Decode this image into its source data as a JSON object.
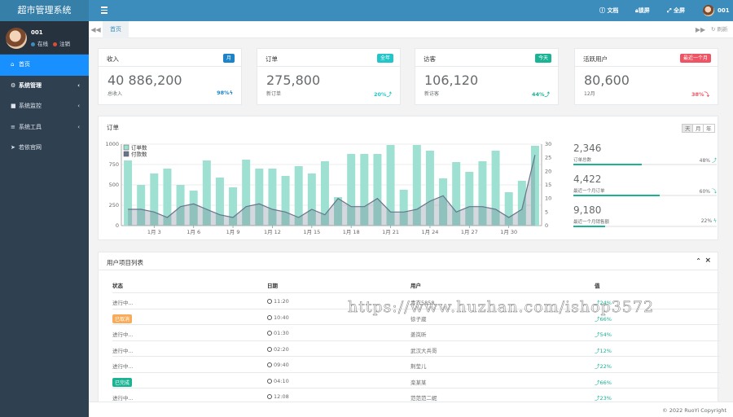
{
  "app": {
    "title": "超市管理系统"
  },
  "user": {
    "name": "001",
    "status": "在线",
    "logout": "注销"
  },
  "sidebar": {
    "items": [
      {
        "icon": "home-icon",
        "label": "首页",
        "arrow": ""
      },
      {
        "icon": "gear-icon",
        "label": "系统管理",
        "arrow": "‹"
      },
      {
        "icon": "video-icon",
        "label": "系统监控",
        "arrow": "‹"
      },
      {
        "icon": "bars-icon",
        "label": "系统工具",
        "arrow": "‹"
      },
      {
        "icon": "location-arrow-icon",
        "label": "若依官网",
        "arrow": ""
      }
    ]
  },
  "topbar": {
    "docs": "文档",
    "lock": "锁屏",
    "fullscreen": "全屏",
    "user": "001"
  },
  "tabs": {
    "home": "首页",
    "refresh": "刷新"
  },
  "stats": [
    {
      "title": "收入",
      "badge": "月",
      "badge_color": "#1c84c6",
      "value": "40 886,200",
      "sub": "总收入",
      "pct": "98%",
      "pct_color": "#1c84c6",
      "icon": "bolt-icon",
      "glyph": "ϟ"
    },
    {
      "title": "订单",
      "badge": "全年",
      "badge_color": "#23c6c8",
      "value": "275,800",
      "sub": "新订单",
      "pct": "20%",
      "pct_color": "#23c6c8",
      "icon": "level-up-icon",
      "glyph": "⤴"
    },
    {
      "title": "访客",
      "badge": "今天",
      "badge_color": "#1ab394",
      "value": "106,120",
      "sub": "新访客",
      "pct": "44%",
      "pct_color": "#1ab394",
      "icon": "level-up-icon",
      "glyph": "⤴"
    },
    {
      "title": "活跃用户",
      "badge": "最近一个月",
      "badge_color": "#ed5565",
      "value": "80,600",
      "sub": "12月",
      "pct": "38%",
      "pct_color": "#ed5565",
      "icon": "level-down-icon",
      "glyph": "⤵"
    }
  ],
  "orders_panel": {
    "title": "订单",
    "periods": [
      "天",
      "月",
      "年"
    ],
    "side_stats": [
      {
        "value": "2,346",
        "label": "订单总数",
        "pct": "48%",
        "icon": "bolt-icon",
        "glyph": "⤴",
        "fill": 0.48
      },
      {
        "value": "4,422",
        "label": "最近一个月订单",
        "pct": "60%",
        "icon": "level-down-icon",
        "glyph": "⤵",
        "fill": 0.6
      },
      {
        "value": "9,180",
        "label": "最近一个月销售额",
        "pct": "22%",
        "icon": "bolt-icon",
        "glyph": "ϟ",
        "fill": 0.22
      }
    ]
  },
  "chart_data": {
    "type": "bar",
    "legend_position": "top-left",
    "series": [
      {
        "name": "订单数",
        "type": "bar",
        "axis": "left",
        "color": "#9ee0d2",
        "values": [
          800,
          500,
          640,
          700,
          500,
          430,
          800,
          590,
          470,
          810,
          700,
          700,
          610,
          730,
          640,
          790,
          350,
          880,
          880,
          880,
          990,
          440,
          990,
          920,
          580,
          780,
          660,
          790,
          920,
          410,
          550,
          980
        ]
      },
      {
        "name": "付款数",
        "type": "line",
        "axis": "right",
        "color": "#67748a",
        "values": [
          6,
          6,
          5,
          3,
          7,
          8,
          6,
          4,
          3,
          7,
          8,
          6,
          5,
          3,
          6,
          4,
          10,
          7,
          7,
          10,
          5,
          5,
          6,
          9,
          11,
          5,
          7,
          7,
          6,
          3,
          6,
          26
        ]
      }
    ],
    "x_ticks": [
      "1月 3",
      "1月 6",
      "1月 9",
      "1月 12",
      "1月 15",
      "1月 18",
      "1月 21",
      "1月 24",
      "1月 27",
      "1月 30"
    ],
    "x_tick_index": [
      2,
      5,
      8,
      11,
      14,
      17,
      20,
      23,
      26,
      29
    ],
    "ylim_left": [
      0,
      1000
    ],
    "yticks_left": [
      "0",
      "250",
      "500",
      "750",
      "1000"
    ],
    "ylim_right": [
      0,
      30
    ],
    "yticks_right": [
      "0",
      "5",
      "10",
      "15",
      "20",
      "25",
      "30"
    ],
    "grid": true
  },
  "project_table": {
    "title": "用户项目列表",
    "collapse": "⌃",
    "close": "×",
    "headers": [
      "状态",
      "日期",
      "用户",
      "值"
    ],
    "rows": [
      {
        "status": "进行中...",
        "label_color": "",
        "time": "11:20",
        "user": "青衣5858",
        "value": "24%"
      },
      {
        "status": "已取消",
        "label_color": "#f8ac59",
        "time": "10:40",
        "user": "徐子崴",
        "value": "66%"
      },
      {
        "status": "进行中...",
        "label_color": "",
        "time": "01:30",
        "user": "姜岚昕",
        "value": "54%"
      },
      {
        "status": "进行中...",
        "label_color": "",
        "time": "02:20",
        "user": "武汉大兵哥",
        "value": "12%"
      },
      {
        "status": "进行中...",
        "label_color": "",
        "time": "09:40",
        "user": "荆莹儿",
        "value": "22%"
      },
      {
        "status": "已完成",
        "label_color": "#1ab394",
        "time": "04:10",
        "user": "栾某某",
        "value": "66%"
      },
      {
        "status": "进行中...",
        "label_color": "",
        "time": "12:08",
        "user": "范范范二妮",
        "value": "23%"
      }
    ]
  },
  "watermark": "https://www.huzhan.com/ishop3572",
  "footer": "© 2022 RuoYi Copyright"
}
